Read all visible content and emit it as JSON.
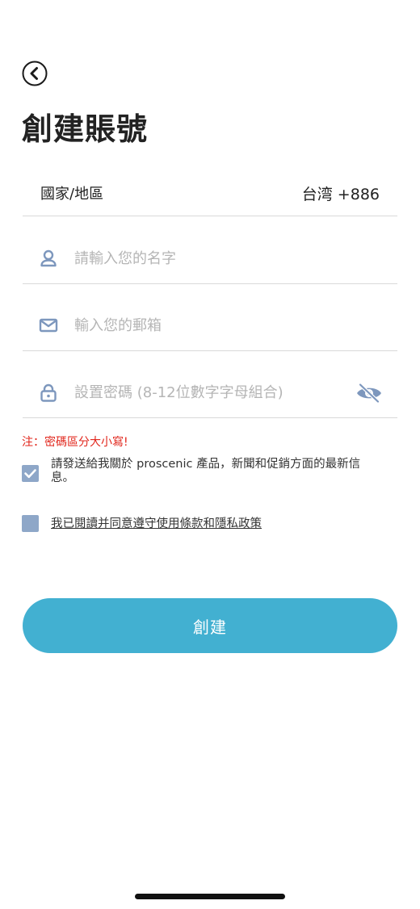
{
  "header": {
    "back_icon": "chevron-left-circle-icon",
    "title": "創建賬號"
  },
  "form": {
    "country": {
      "label": "國家/地區",
      "value": "台湾 +886"
    },
    "name": {
      "icon": "user-icon",
      "placeholder": "請輸入您的名字",
      "value": ""
    },
    "email": {
      "icon": "envelope-icon",
      "placeholder": "輸入您的郵箱",
      "value": ""
    },
    "password": {
      "icon": "lock-icon",
      "placeholder": "設置密碼 (8-12位數字字母組合)",
      "value": "",
      "toggle_icon": "eye-off-icon"
    }
  },
  "note": "注：密碼區分大小寫!",
  "consent": {
    "checked": true,
    "text": "請發送給我關於 proscenic 產品，新聞和促銷方面的最新信息。"
  },
  "terms": {
    "checked": false,
    "text": "我已閱讀并同意遵守使用條款和隱私政策"
  },
  "submit": {
    "label": "創建"
  },
  "colors": {
    "accent": "#42b0d1",
    "icon": "#7d97bd",
    "checkbox": "#8ea7c8",
    "note": "#e1251b",
    "divider": "#d9d9d9",
    "placeholder": "#b5b5b5"
  }
}
